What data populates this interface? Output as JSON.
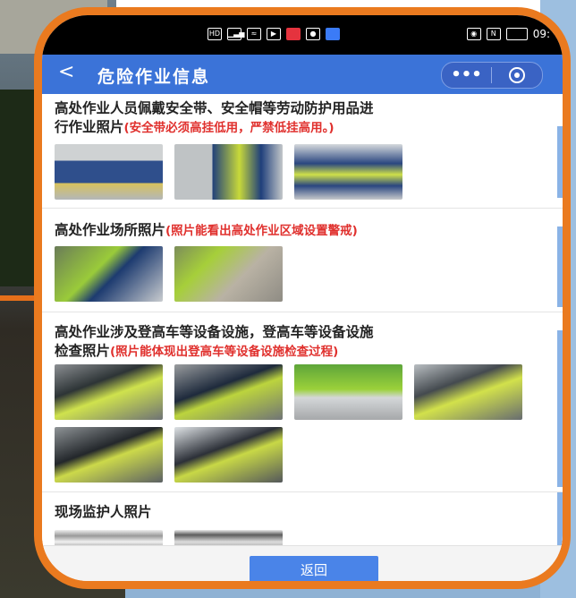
{
  "statusbar": {
    "left_icons": [
      "hd-icon",
      "signal-icon",
      "wifi-icon",
      "app-icon",
      "notification-icon",
      "record-icon"
    ],
    "hd_label": "HD",
    "time": "09:"
  },
  "navbar": {
    "back_symbol": "<",
    "title": "危险作业信息",
    "menu_dots": "•••"
  },
  "sections": [
    {
      "title_line1": "高处作业人员佩戴安全带、安全帽等劳动防护用品进",
      "title_line2": "行作业照片",
      "note": "(安全带必须高挂低用，严禁低挂高用。)",
      "photo_count": 3
    },
    {
      "title": "高处作业场所照片",
      "note": "(照片能看出高处作业区域设置警戒)",
      "photo_count": 2
    },
    {
      "title_line1": "高处作业涉及登高车等设备设施，登高车等设备设施",
      "title_line2": "检查照片",
      "note": "(照片能体现出登高车等设备设施检查过程)",
      "photo_count": 6
    },
    {
      "title": "现场监护人照片",
      "photo_count": 2
    }
  ],
  "footer": {
    "back_button": "返回"
  },
  "colors": {
    "frame_border": "#ea7a1f",
    "navbar": "#3b73d8",
    "note_red": "#e0302d",
    "button_blue": "#4a84e8"
  }
}
